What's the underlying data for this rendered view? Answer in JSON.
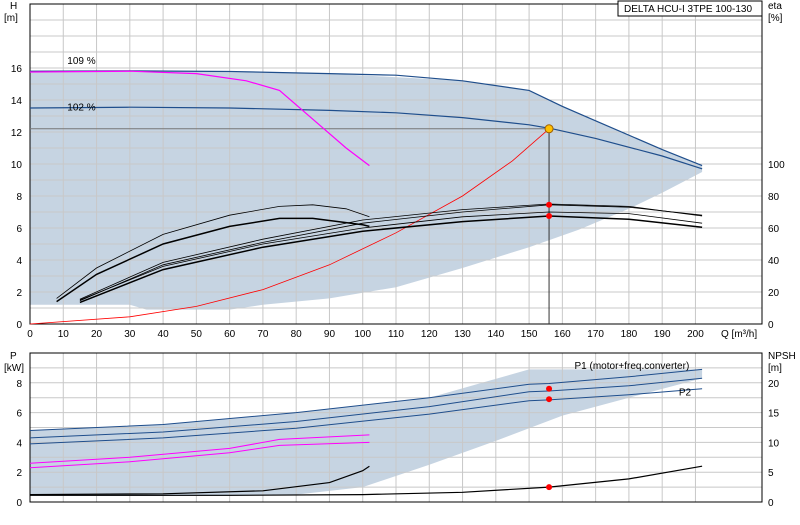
{
  "chart_data": [
    {
      "type": "line",
      "id": "top",
      "title": "DELTA HCU-I 3TPE 100-130",
      "ylabel": "H",
      "ylabel_unit": "[m]",
      "y2label": "eta",
      "y2label_unit": "[%]",
      "xlabel": "Q [m³/h]",
      "xlim": [
        0,
        220
      ],
      "ylim": [
        0,
        20
      ],
      "y2lim": [
        0,
        200
      ],
      "xticks": [
        0,
        10,
        20,
        30,
        40,
        50,
        60,
        70,
        80,
        90,
        100,
        110,
        120,
        130,
        140,
        150,
        160,
        170,
        180,
        190,
        200
      ],
      "yticks": [
        0,
        2,
        4,
        6,
        8,
        10,
        12,
        14,
        16
      ],
      "y2ticks": [
        0,
        20,
        40,
        60,
        80,
        100
      ],
      "grid": true,
      "annotations": [
        {
          "text": "109 %",
          "x": 7,
          "y": 16.0
        },
        {
          "text": "102 %",
          "x": 7,
          "y": 13.1
        }
      ],
      "operating_point": {
        "x": 156,
        "y": 12.2
      },
      "series": [
        {
          "color": "#1f4e8c",
          "width": 1.2,
          "points": [
            [
              0,
              15.8
            ],
            [
              30,
              15.82
            ],
            [
              60,
              15.78
            ],
            [
              90,
              15.65
            ],
            [
              110,
              15.55
            ],
            [
              130,
              15.2
            ],
            [
              150,
              14.6
            ],
            [
              160,
              13.6
            ],
            [
              170,
              12.7
            ],
            [
              190,
              10.9
            ],
            [
              202,
              9.9
            ]
          ]
        },
        {
          "color": "#1f4e8c",
          "width": 1.2,
          "points": [
            [
              0,
              13.5
            ],
            [
              30,
              13.55
            ],
            [
              60,
              13.5
            ],
            [
              90,
              13.35
            ],
            [
              110,
              13.2
            ],
            [
              130,
              12.9
            ],
            [
              150,
              12.45
            ],
            [
              157,
              12.2
            ],
            [
              170,
              11.6
            ],
            [
              190,
              10.5
            ],
            [
              202,
              9.7
            ]
          ]
        },
        {
          "color": "#ff00ff",
          "width": 1.2,
          "points": [
            [
              0,
              15.75
            ],
            [
              30,
              15.8
            ],
            [
              50,
              15.65
            ],
            [
              65,
              15.2
            ],
            [
              75,
              14.6
            ],
            [
              85,
              12.8
            ],
            [
              95,
              11.0
            ],
            [
              102,
              9.9
            ]
          ]
        },
        {
          "color": "#ff0000",
          "width": 0.8,
          "points": [
            [
              0,
              0
            ],
            [
              30,
              0.45
            ],
            [
              50,
              1.1
            ],
            [
              70,
              2.15
            ],
            [
              90,
              3.7
            ],
            [
              110,
              5.7
            ],
            [
              130,
              8.0
            ],
            [
              145,
              10.2
            ],
            [
              156,
              12.2
            ]
          ]
        },
        {
          "color": "#000000",
          "width": 1.5,
          "points": [
            [
              8,
              1.4
            ],
            [
              20,
              3.1
            ],
            [
              40,
              5.0
            ],
            [
              60,
              6.1
            ],
            [
              75,
              6.6
            ],
            [
              85,
              6.6
            ],
            [
              100,
              6.2
            ],
            [
              102,
              6.1
            ]
          ]
        },
        {
          "color": "#000000",
          "width": 0.8,
          "points": [
            [
              8,
              1.6
            ],
            [
              20,
              3.5
            ],
            [
              40,
              5.6
            ],
            [
              60,
              6.8
            ],
            [
              75,
              7.35
            ],
            [
              85,
              7.45
            ],
            [
              95,
              7.2
            ],
            [
              102,
              6.7
            ]
          ]
        },
        {
          "color": "#000000",
          "width": 1.5,
          "points": [
            [
              15,
              1.35
            ],
            [
              40,
              3.4
            ],
            [
              70,
              4.8
            ],
            [
              100,
              5.8
            ],
            [
              130,
              6.4
            ],
            [
              156,
              6.75
            ],
            [
              180,
              6.55
            ],
            [
              202,
              6.05
            ]
          ]
        },
        {
          "color": "#000000",
          "width": 0.8,
          "points": [
            [
              15,
              1.45
            ],
            [
              40,
              3.7
            ],
            [
              70,
              5.1
            ],
            [
              100,
              6.3
            ],
            [
              130,
              7.0
            ],
            [
              156,
              7.45
            ],
            [
              180,
              7.3
            ],
            [
              202,
              6.8
            ]
          ]
        },
        {
          "color": "#000000",
          "width": 0.8,
          "points": [
            [
              15,
              1.55
            ],
            [
              40,
              3.85
            ],
            [
              70,
              5.3
            ],
            [
              100,
              6.5
            ],
            [
              130,
              7.15
            ],
            [
              156,
              7.5
            ],
            [
              180,
              7.35
            ],
            [
              202,
              6.75
            ]
          ]
        },
        {
          "color": "#000000",
          "width": 0.8,
          "points": [
            [
              15,
              1.5
            ],
            [
              40,
              3.6
            ],
            [
              70,
              5.0
            ],
            [
              100,
              6.0
            ],
            [
              130,
              6.7
            ],
            [
              156,
              7.0
            ],
            [
              180,
              6.9
            ],
            [
              202,
              6.3
            ]
          ]
        }
      ],
      "markers": [
        [
          156,
          7.45
        ],
        [
          156,
          6.75
        ]
      ]
    },
    {
      "type": "line",
      "id": "bottom",
      "ylabel": "P",
      "ylabel_unit": "[kW]",
      "y2label": "NPSH",
      "y2label_unit": "[m]",
      "xlim": [
        0,
        220
      ],
      "ylim": [
        0,
        10
      ],
      "y2lim": [
        0,
        25
      ],
      "yticks": [
        0,
        2,
        4,
        6,
        8
      ],
      "y2ticks": [
        0,
        5,
        10,
        15,
        20
      ],
      "grid": true,
      "legend_labels": [
        {
          "text": "P1 (motor+freq.converter)",
          "x": 188,
          "y": 9.2
        },
        {
          "text": "P2",
          "x": 195,
          "y": 7.4
        }
      ],
      "series": [
        {
          "color": "#1f4e8c",
          "width": 1.0,
          "points": [
            [
              0,
              4.8
            ],
            [
              40,
              5.2
            ],
            [
              80,
              6.0
            ],
            [
              120,
              7.0
            ],
            [
              150,
              7.9
            ],
            [
              156,
              7.95
            ],
            [
              180,
              8.4
            ],
            [
              202,
              8.9
            ]
          ]
        },
        {
          "color": "#1f4e8c",
          "width": 1.0,
          "points": [
            [
              0,
              4.3
            ],
            [
              40,
              4.7
            ],
            [
              80,
              5.4
            ],
            [
              120,
              6.4
            ],
            [
              150,
              7.4
            ],
            [
              156,
              7.45
            ],
            [
              180,
              7.8
            ],
            [
              202,
              8.3
            ]
          ]
        },
        {
          "color": "#1f4e8c",
          "width": 1.0,
          "points": [
            [
              0,
              3.9
            ],
            [
              40,
              4.3
            ],
            [
              80,
              4.95
            ],
            [
              120,
              5.9
            ],
            [
              150,
              6.8
            ],
            [
              156,
              6.85
            ],
            [
              180,
              7.2
            ],
            [
              202,
              7.6
            ]
          ]
        },
        {
          "color": "#ff00ff",
          "width": 1.0,
          "points": [
            [
              0,
              2.6
            ],
            [
              30,
              3.0
            ],
            [
              60,
              3.6
            ],
            [
              75,
              4.2
            ],
            [
              102,
              4.5
            ]
          ]
        },
        {
          "color": "#ff00ff",
          "width": 1.0,
          "points": [
            [
              0,
              2.3
            ],
            [
              30,
              2.7
            ],
            [
              60,
              3.3
            ],
            [
              75,
              3.8
            ],
            [
              102,
              4.0
            ]
          ]
        },
        {
          "color": "#000000",
          "width": 1.2,
          "points": [
            [
              0,
              0.5
            ],
            [
              40,
              0.55
            ],
            [
              70,
              0.75
            ],
            [
              90,
              1.3
            ],
            [
              100,
              2.1
            ],
            [
              102,
              2.4
            ]
          ]
        },
        {
          "color": "#000000",
          "width": 1.2,
          "points": [
            [
              0,
              0.45
            ],
            [
              60,
              0.45
            ],
            [
              100,
              0.5
            ],
            [
              130,
              0.65
            ],
            [
              156,
              1.0
            ],
            [
              180,
              1.55
            ],
            [
              202,
              2.4
            ]
          ]
        }
      ],
      "markers": [
        [
          156,
          7.6
        ],
        [
          156,
          6.9
        ],
        [
          156,
          1.0
        ]
      ]
    }
  ]
}
